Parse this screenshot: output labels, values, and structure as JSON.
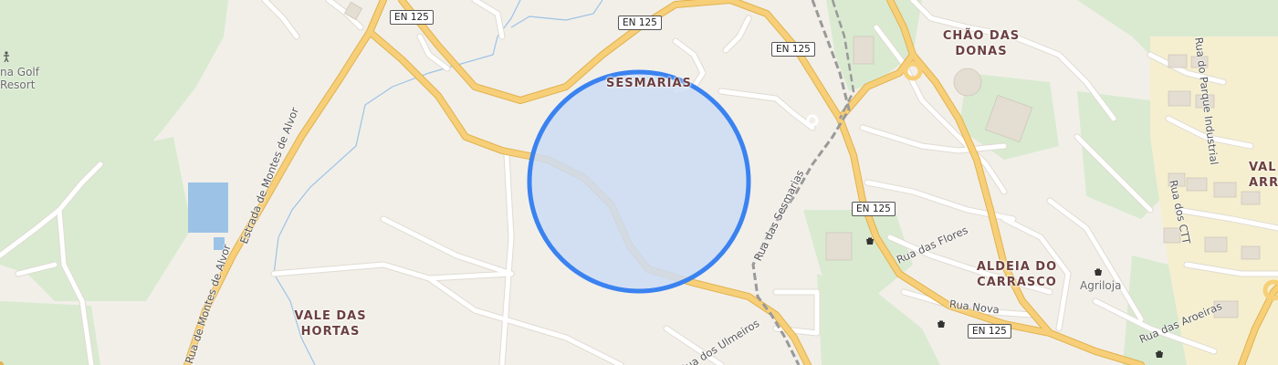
{
  "map": {
    "areas": [
      {
        "id": "sesmarias",
        "lines": [
          "SESMARIAS"
        ]
      },
      {
        "id": "chao-das-donas",
        "lines": [
          "CHÃO DAS",
          "DONAS"
        ]
      },
      {
        "id": "aldeia-do-carrasco",
        "lines": [
          "ALDEIA DO",
          "CARRASCO"
        ]
      },
      {
        "id": "vale-das-hortas",
        "lines": [
          "VALE DAS",
          "HORTAS"
        ]
      },
      {
        "id": "vale-arra",
        "lines": [
          "VAL",
          "ARRA"
        ]
      }
    ],
    "pois": [
      {
        "id": "golf-resort",
        "lines": [
          "na Golf",
          "Resort"
        ]
      },
      {
        "id": "agriloja",
        "lines": [
          "Agriloja"
        ]
      }
    ],
    "streets": [
      "Estrada de Montes de Alvor",
      "Rua das Sesmarias",
      "Rua das Flores",
      "Rua Nova",
      "Rua dos Ulmeiros",
      "Rua do Parque Industrial",
      "Rua dos CTT",
      "Rua das Aroeiras",
      "Rua de Montes de Alvor"
    ],
    "road_shields": [
      "EN 125",
      "EN 125",
      "EN 125",
      "EN 125",
      "EN 125"
    ],
    "location_circle": {
      "fill": "#cddcf5",
      "stroke": "#3a82f0"
    },
    "colors": {
      "land": "#f2efe9",
      "green": "#d9ead0",
      "major_road": "#f5c96a",
      "minor_road": "#ffffff",
      "water": "#9cc3e6",
      "rail": "#888888"
    }
  }
}
